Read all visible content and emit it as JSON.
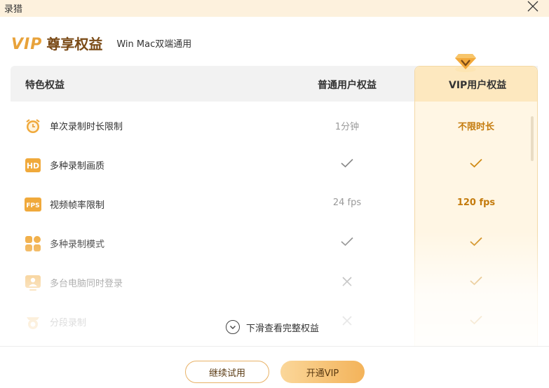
{
  "window": {
    "title": "录猎"
  },
  "header": {
    "vip_word": "VIP",
    "title": "尊享权益",
    "subtitle": "Win Mac双端通用"
  },
  "table": {
    "headers": {
      "feature": "特色权益",
      "normal": "普通用户权益",
      "vip": "VIP用户权益"
    },
    "rows": [
      {
        "icon": "alarm-clock-icon",
        "label": "单次录制时长限制",
        "normal": "1分钟",
        "vip": "不限时长"
      },
      {
        "icon": "hd-icon",
        "label": "多种录制画质",
        "normal": "check",
        "vip": "check"
      },
      {
        "icon": "fps-icon",
        "label": "视频帧率限制",
        "normal": "24 fps",
        "vip": "120 fps"
      },
      {
        "icon": "grid-icon",
        "label": "多种录制模式",
        "normal": "check",
        "vip": "check"
      },
      {
        "icon": "user-screen-icon",
        "label": "多台电脑同时登录",
        "normal": "cross",
        "vip": "check"
      },
      {
        "icon": "camera-icon",
        "label": "分段录制",
        "normal": "cross",
        "vip": "check"
      }
    ]
  },
  "scroll_hint": "下滑查看完整权益",
  "buttons": {
    "trial": "继续试用",
    "open_vip": "开通VIP"
  },
  "colors": {
    "accent": "#e8a23a",
    "vip_text": "#c47b0d",
    "title_brown": "#7a4a16"
  }
}
